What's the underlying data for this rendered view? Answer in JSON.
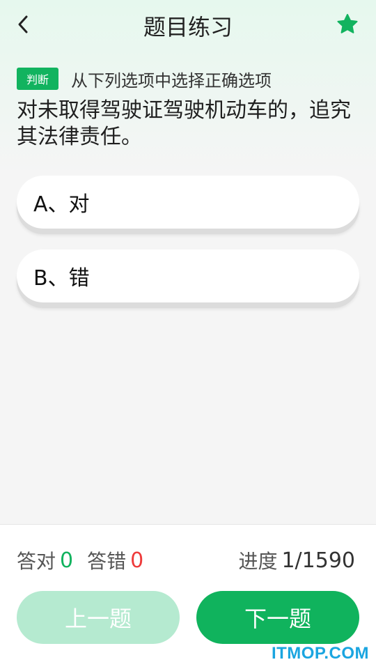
{
  "header": {
    "title": "题目练习",
    "back_icon": "chevron-left-icon",
    "favorite_icon": "star-icon",
    "accent_color": "#12b35f"
  },
  "question": {
    "type_badge": "判断",
    "instruction": "从下列选项中选择正确选项",
    "text": "对未取得驾驶证驾驶机动车的，追究其法律责任。"
  },
  "options": [
    {
      "label": "A、对"
    },
    {
      "label": "B、错"
    }
  ],
  "stats": {
    "right_label": "答对",
    "right_count": "0",
    "wrong_label": "答错",
    "wrong_count": "0",
    "progress_label": "进度",
    "progress_value": "1/1590"
  },
  "buttons": {
    "prev_label": "上一题",
    "next_label": "下一题"
  },
  "watermark": "ITMOP.COM"
}
